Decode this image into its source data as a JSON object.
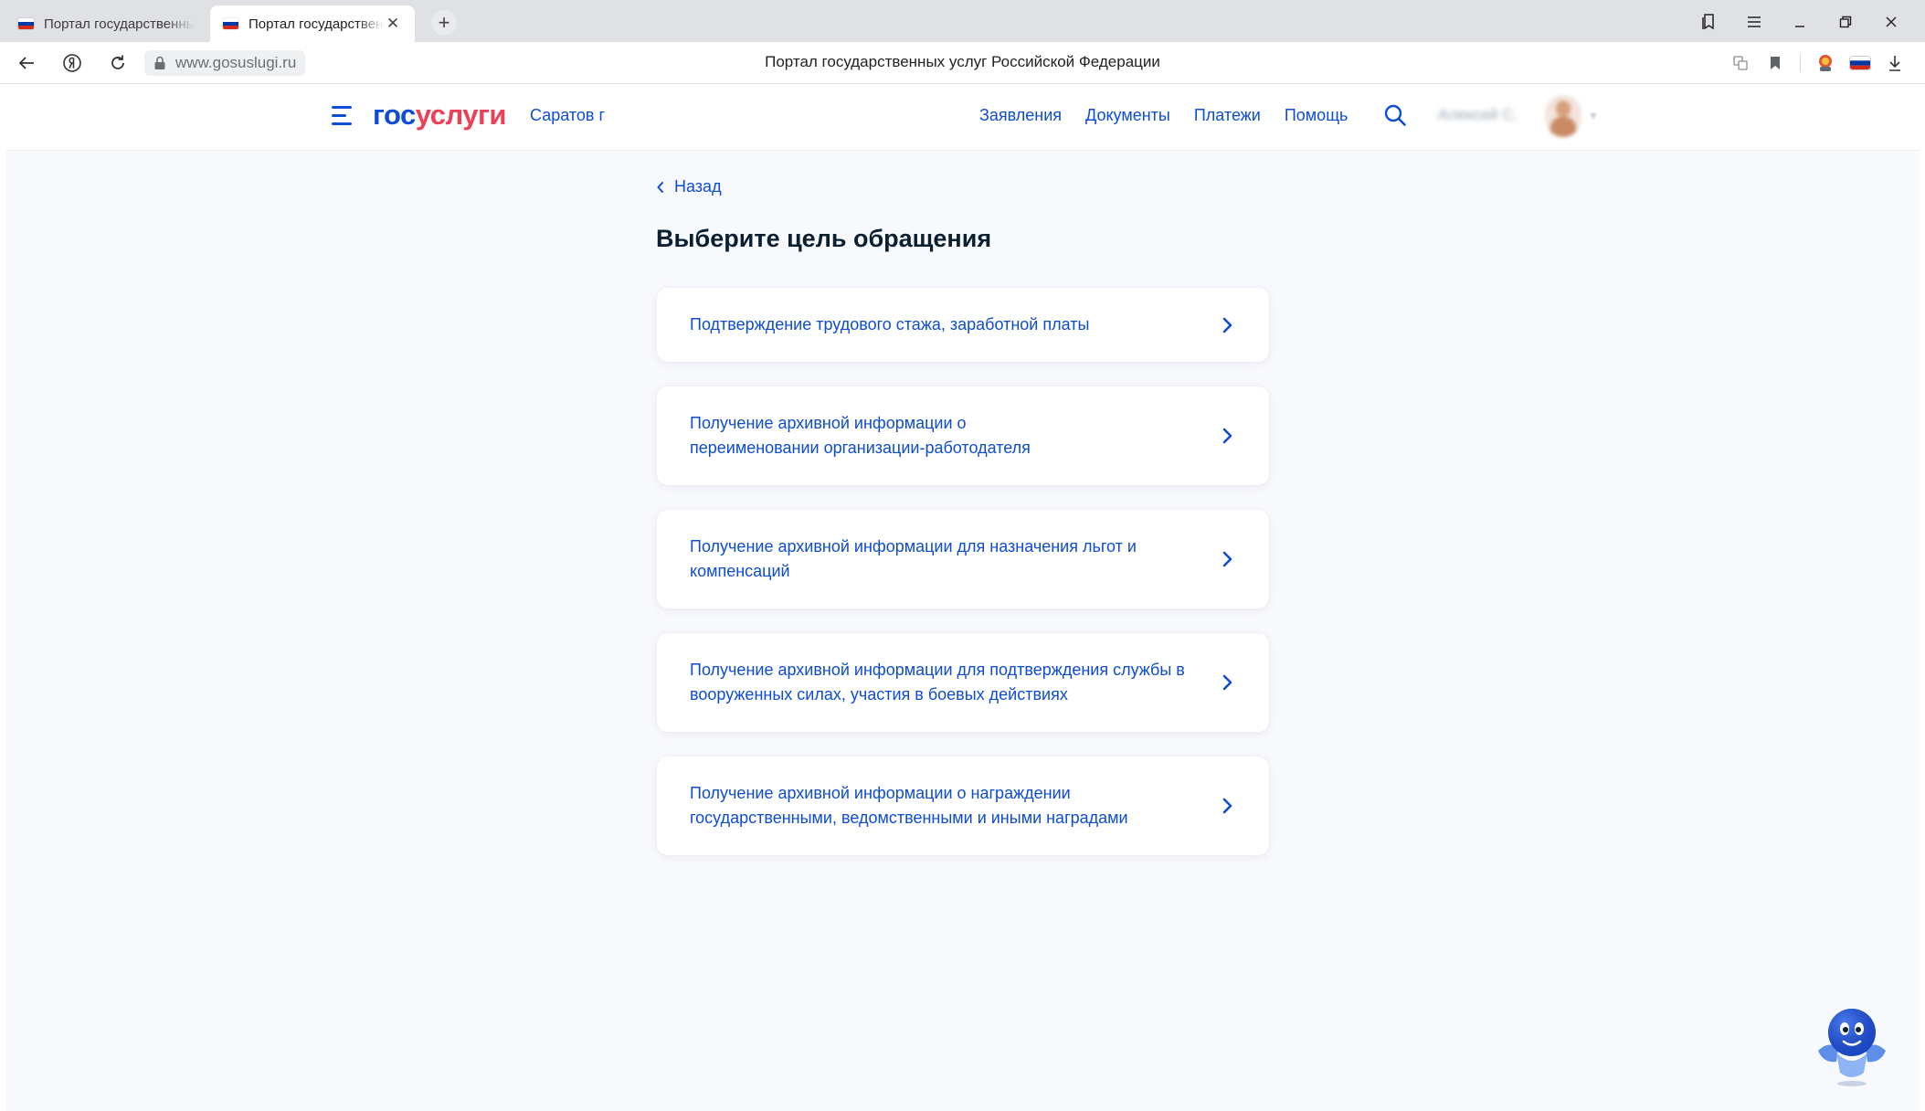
{
  "browser": {
    "tabs": [
      {
        "title": "Портал государственных услуг Российской Федерации",
        "active": false
      },
      {
        "title": "Портал государственных услуг Российской Федерации",
        "active": true
      }
    ],
    "tab_close_glyph": "✕",
    "new_tab_glyph": "+",
    "url": "www.gosuslugi.ru",
    "page_title": "Портал государственных услуг Российской Федерации",
    "flag_colors": [
      "#ffffff",
      "#0039a6",
      "#d52b1e"
    ]
  },
  "header": {
    "logo_part1": "гос",
    "logo_part2": "услуги",
    "region": "Саратов г",
    "nav": [
      "Заявления",
      "Документы",
      "Платежи",
      "Помощь"
    ],
    "user_name": "Алексей С."
  },
  "page": {
    "back_label": "Назад",
    "title": "Выберите цель обращения",
    "goals": [
      "Подтверждение трудового стажа, заработной платы",
      "Получение архивной информации о переименовании организации-работодателя",
      "Получение архивной информации для назначения льгот и компенсаций",
      "Получение архивной информации для подтверждения службы в вооруженных силах, участия в боевых действиях",
      "Получение архивной информации о награждении государственными, ведомственными и иными наградами"
    ]
  },
  "colors": {
    "accent": "#0d4cd3",
    "logo_red": "#ee3f58",
    "text": "#0b1f33",
    "background": "#f8f9fd"
  },
  "icons": {
    "back": "chevron-left-icon",
    "goal": "chevron-right-icon",
    "search": "search-icon",
    "menu": "hamburger-icon",
    "assistant": "robot-assistant-icon"
  }
}
